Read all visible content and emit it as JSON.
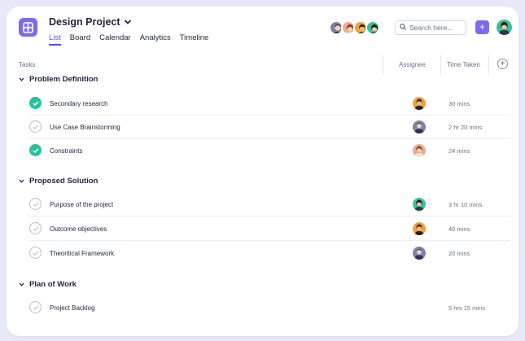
{
  "project": {
    "title": "Design Project"
  },
  "tabs": [
    {
      "label": "List",
      "active": true
    },
    {
      "label": "Board",
      "active": false
    },
    {
      "label": "Calendar",
      "active": false
    },
    {
      "label": "Analytics",
      "active": false
    },
    {
      "label": "Timeline",
      "active": false
    }
  ],
  "search": {
    "placeholder": "Search here..."
  },
  "toolbar": {
    "add_label": "+"
  },
  "columns": {
    "tasks": "Tasks",
    "assignee": "Assignee",
    "time_taken": "Time Taken",
    "add": "+"
  },
  "sections": [
    {
      "title": "Problem Definition",
      "tasks": [
        {
          "name": "Secondary research",
          "done": true,
          "assignee": "avatar-orange",
          "time": "30 mins"
        },
        {
          "name": "Use Case Brainstorming",
          "done": false,
          "assignee": "avatar-purple",
          "time": "2 hr 20 mins"
        },
        {
          "name": "Constraints",
          "done": true,
          "assignee": "avatar-pink",
          "time": "24 mins"
        }
      ]
    },
    {
      "title": "Proposed Solution",
      "tasks": [
        {
          "name": "Purpose of the project",
          "done": false,
          "assignee": "avatar-teal",
          "time": "3 hr 10 mins"
        },
        {
          "name": "Outcome objectives",
          "done": false,
          "assignee": "avatar-orange",
          "time": "40 mins"
        },
        {
          "name": "Theoritical Framework",
          "done": false,
          "assignee": "avatar-purple",
          "time": "20 mins"
        }
      ]
    },
    {
      "title": "Plan of Work",
      "tasks": [
        {
          "name": "Project Backlog",
          "done": false,
          "assignee": null,
          "time": "5 hrs 15 mins"
        }
      ]
    }
  ],
  "colors": {
    "accent": "#7c6bf0",
    "tab_active": "#5b4fe0",
    "check_done": "#26c2a0",
    "avatar-purple": "#7d82a8",
    "avatar-pink": "#f2a98f",
    "avatar-orange": "#f0a23a",
    "avatar-teal": "#3bbf9a"
  }
}
